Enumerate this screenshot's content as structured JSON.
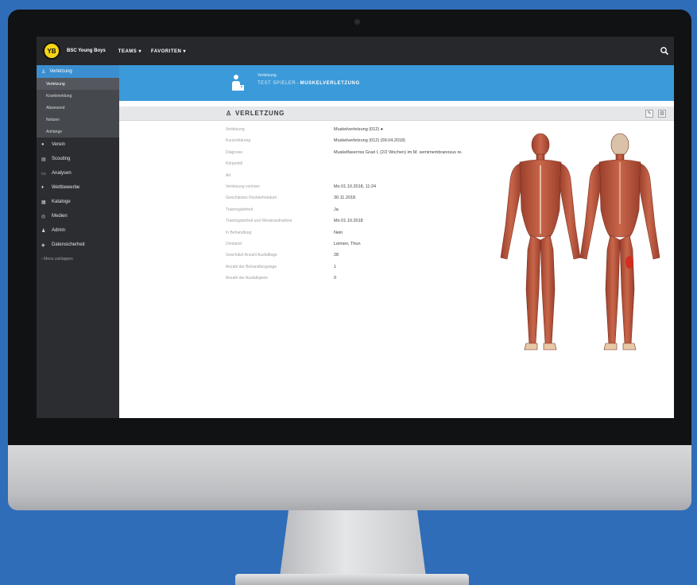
{
  "app": {
    "club_name": "BSC Young Boys",
    "logo_text": "YB",
    "nav": [
      "TEAMS ▾",
      "FAVORITEN ▾"
    ]
  },
  "sidebar": {
    "active": "Verletzung",
    "subitems": [
      "Verletzung",
      "Krankmeldung",
      "Abwesend",
      "Notizen",
      "Anhänge"
    ],
    "items": [
      {
        "icon": "●",
        "label": "Verein"
      },
      {
        "icon": "▤",
        "label": "Scouting"
      },
      {
        "icon": "▭",
        "label": "Analysen"
      },
      {
        "icon": "♦",
        "label": "Wettbewerbe"
      },
      {
        "icon": "▦",
        "label": "Kataloge"
      },
      {
        "icon": "◎",
        "label": "Medien"
      },
      {
        "icon": "♟",
        "label": "Admin"
      },
      {
        "icon": "◈",
        "label": "Datensicherheit"
      }
    ],
    "collapse": "‹  Menu zuklappen"
  },
  "banner": {
    "small": "Verletzung",
    "player": "TEST SPIELER",
    "separator": "-",
    "title": "MUSKELVERLETZUNG"
  },
  "panel": {
    "title": "VERLETZUNG",
    "edit": "✎",
    "delete": "▥"
  },
  "details": [
    {
      "label": "Verletzung",
      "value": "Muskelverletzung (012)  ●"
    },
    {
      "label": "Kurzerklärung",
      "value": "Muskelverletzung (012) (09.04.2018)"
    },
    {
      "label": "Diagnose",
      "value": "Muskelfaserriss Grad I, (2/2 Wochen) im M. semimembranosus re."
    },
    {
      "label": "Körperteil",
      "value": ""
    },
    {
      "label": "Art",
      "value": ""
    },
    {
      "label": "Verletzung vom/am",
      "value": "Mo 01.10.2018, 11:24"
    },
    {
      "label": "Geschätztes Rückkehrdatum",
      "value": "30.11.2018"
    },
    {
      "label": "Trainingsbefreit",
      "value": "Ja"
    },
    {
      "label": "Trainingsbefreit und Wiederaufnahme",
      "value": "Mo 01.10.2018"
    },
    {
      "label": "In Behandlung",
      "value": "Nein"
    },
    {
      "label": "Umstand",
      "value": "Leimen, Thun"
    },
    {
      "label": "Geschätzt Anzahl Ausfalltage",
      "value": "28"
    },
    {
      "label": "Anzahl der Behandlungstage",
      "value": "1"
    },
    {
      "label": "Anzahl der Ausfallspiele",
      "value": "0"
    }
  ],
  "colors": {
    "accent": "#3b9ad9",
    "sidebar": "#2b2d31",
    "topbar": "#26282c",
    "injury_marker": "#d42a1c",
    "muscle": "#b8543c"
  }
}
